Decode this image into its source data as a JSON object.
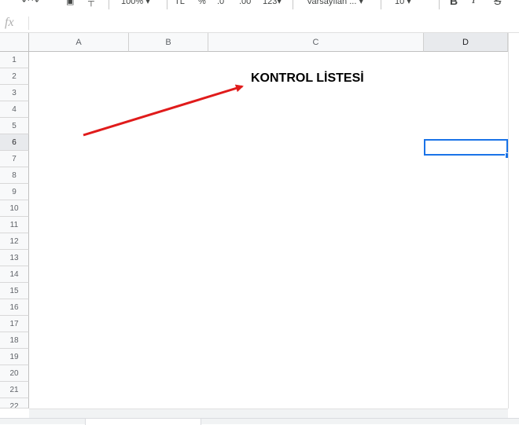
{
  "toolbar": {
    "zoom": "100%",
    "currency": "TL",
    "percent": "%",
    "decimal_decrease": ".0",
    "decimal_increase": ".00",
    "number_format": "123",
    "font": "Varsayılan ...",
    "font_size": "10",
    "bold": "B",
    "italic": "I",
    "strike": "S"
  },
  "formula_bar": {
    "fx_label": "fx",
    "value": ""
  },
  "columns": [
    "A",
    "B",
    "C",
    "D"
  ],
  "selected_column": "D",
  "rows": [
    "1",
    "2",
    "3",
    "4",
    "5",
    "6",
    "7",
    "8",
    "9",
    "10",
    "11",
    "12",
    "13",
    "14",
    "15",
    "16",
    "17",
    "18",
    "19",
    "20",
    "21",
    "22"
  ],
  "selected_row": "6",
  "cells": {
    "C2": "KONTROL LİSTESİ"
  },
  "active_cell": "D6",
  "annotation": {
    "type": "arrow",
    "color": "#e01b1b"
  },
  "colors": {
    "accent": "#1a73e8",
    "arrow": "#e01b1b"
  }
}
